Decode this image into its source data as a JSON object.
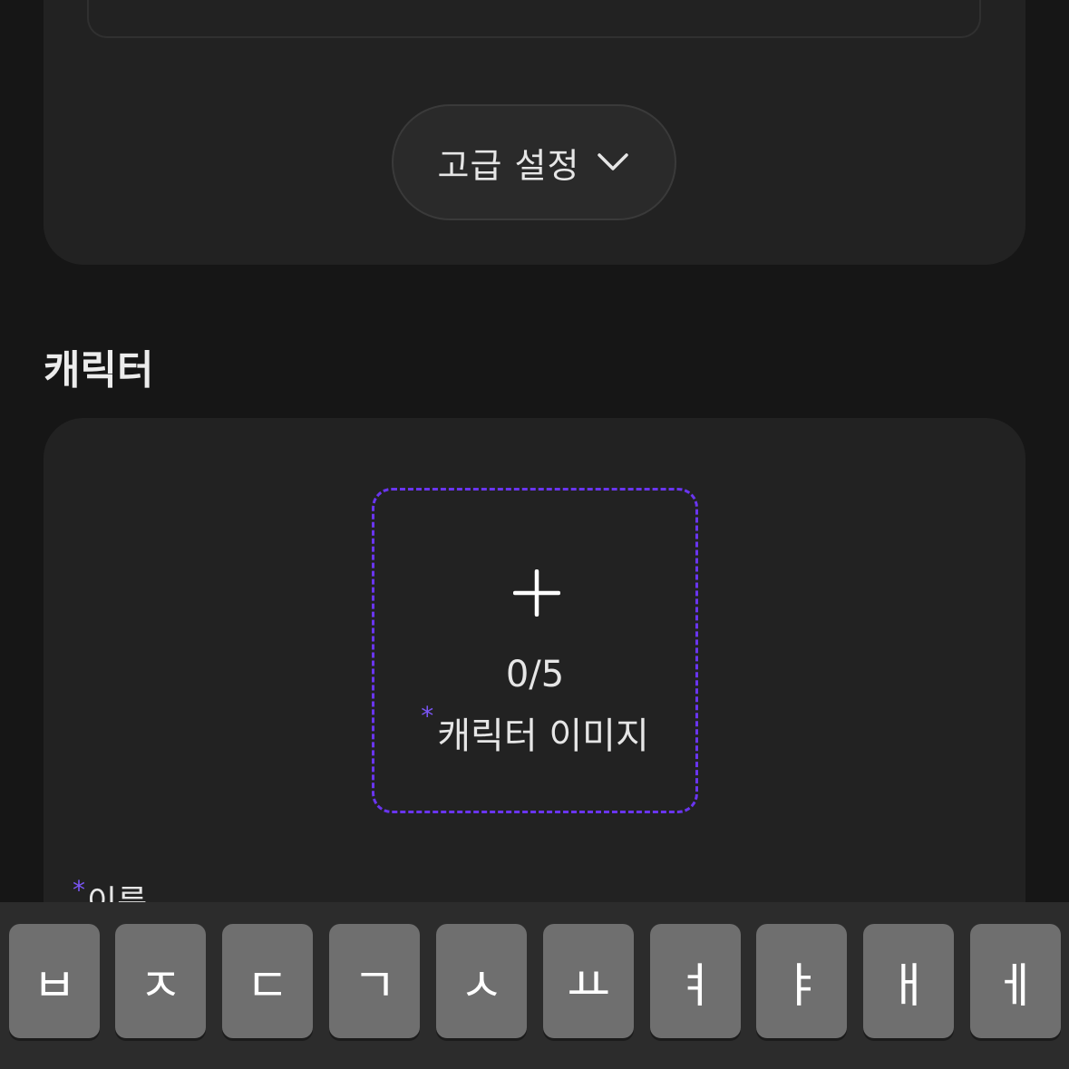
{
  "settings": {
    "advanced_label": "고급 설정",
    "chevron_icon": "chevron-down-icon"
  },
  "character_section": {
    "title": "캐릭터",
    "image_upload": {
      "plus_icon": "plus-icon",
      "count": "0/5",
      "required_mark": "*",
      "label": "캐릭터 이미지"
    },
    "name_field": {
      "required_mark": "*",
      "label": "이름"
    }
  },
  "keyboard": {
    "keys": [
      "ㅂ",
      "ㅈ",
      "ㄷ",
      "ㄱ",
      "ㅅ",
      "ㅛ",
      "ㅕ",
      "ㅑ",
      "ㅐ",
      "ㅔ"
    ]
  },
  "colors": {
    "background": "#161616",
    "card": "#222222",
    "accent": "#6a35f0",
    "key": "#6f6f6f"
  }
}
